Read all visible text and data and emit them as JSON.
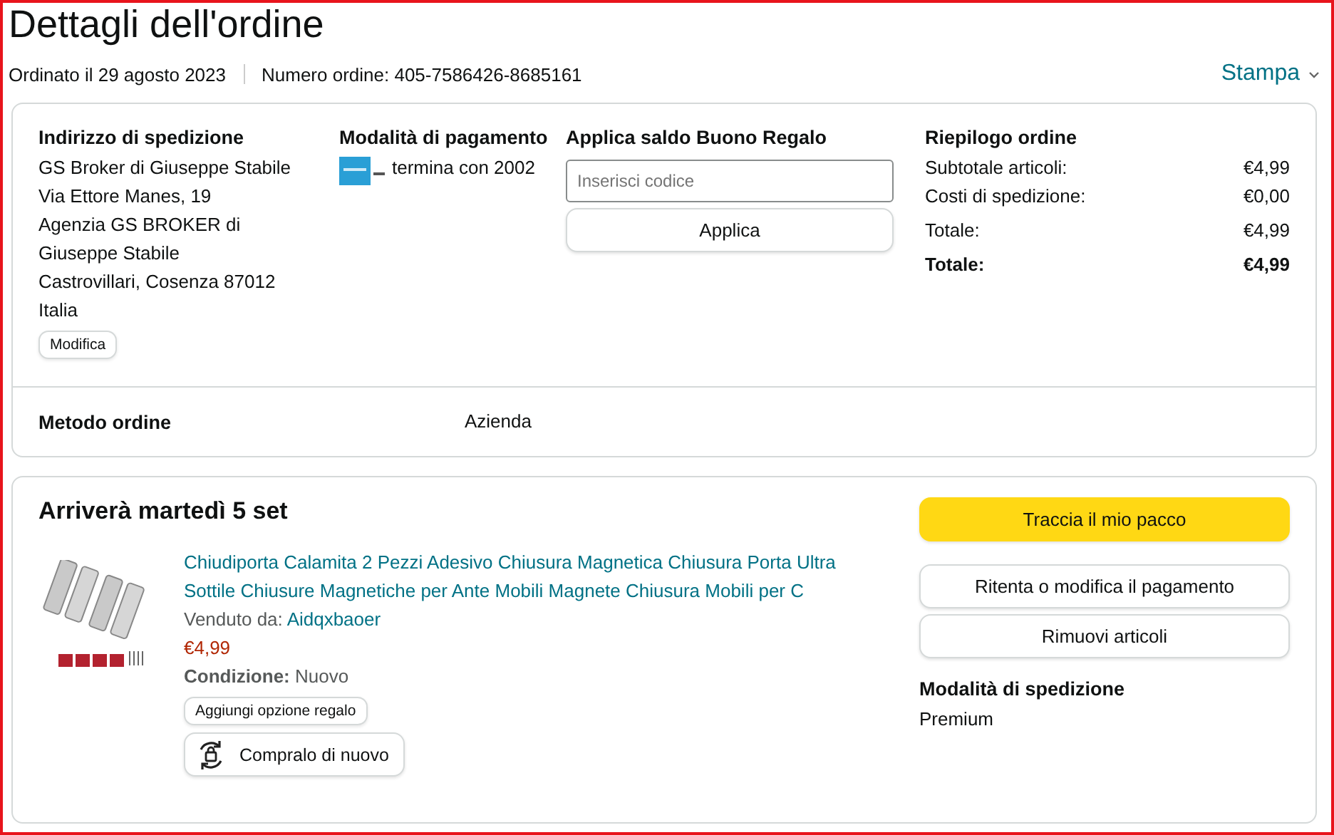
{
  "title": "Dettagli dell'ordine",
  "order_meta": {
    "date": "Ordinato il 29 agosto 2023",
    "number": "Numero ordine: 405-7586426-8685161",
    "print": "Stampa"
  },
  "shipping_address": {
    "heading": "Indirizzo di spedizione",
    "lines": [
      "GS Broker di Giuseppe Stabile",
      "Via Ettore Manes, 19",
      "Agenzia GS BROKER di Giuseppe Stabile",
      "Castrovillari, Cosenza 87012",
      "Italia"
    ],
    "edit_button": "Modifica"
  },
  "payment": {
    "heading": "Modalità di pagamento",
    "card": "termina con 2002"
  },
  "gift_card": {
    "heading": "Applica saldo Buono Regalo",
    "placeholder": "Inserisci codice",
    "button": "Applica"
  },
  "summary": {
    "heading": "Riepilogo ordine",
    "rows": [
      {
        "label": "Subtotale articoli:",
        "value": "€4,99",
        "kind": "line"
      },
      {
        "label": "Costi di spedizione:",
        "value": "€0,00",
        "kind": "line"
      },
      {
        "label": "Totale:",
        "value": "€4,99",
        "kind": "line"
      },
      {
        "label": "Totale:",
        "value": "€4,99",
        "kind": "total"
      }
    ]
  },
  "order_method": {
    "label": "Metodo ordine",
    "value": "Azienda"
  },
  "shipment": {
    "heading": "Arriverà martedì 5 set",
    "item": {
      "title": "Chiudiporta Calamita 2 Pezzi Adesivo Chiusura Magnetica Chiusura Porta Ultra Sottile Chiusure Magnetiche per Ante Mobili Magnete Chiusura Mobili per C",
      "seller_label": "Venduto da:",
      "seller": "Aidqxbaoer",
      "price": "€4,99",
      "condition_label": "Condizione:",
      "condition": "Nuovo",
      "gift_button": "Aggiungi opzione regalo",
      "buy_again_button": "Compralo di nuovo"
    },
    "actions": [
      {
        "label": "Traccia il mio pacco",
        "kind": "primary"
      },
      {
        "label": "Ritenta o modifica il pagamento",
        "kind": "secondary"
      },
      {
        "label": "Rimuovi articoli",
        "kind": "secondary"
      }
    ],
    "shipping_mode": {
      "heading": "Modalità di spedizione",
      "value": "Premium"
    }
  }
}
